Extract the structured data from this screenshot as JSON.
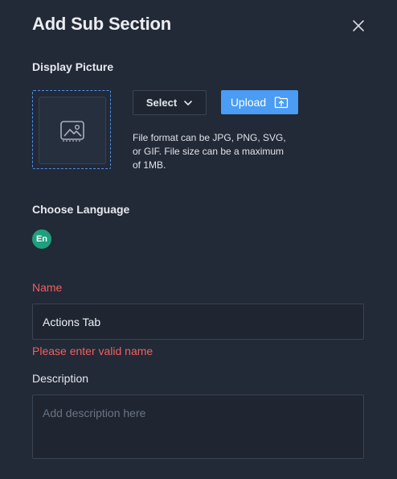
{
  "dialog": {
    "title": "Add Sub Section",
    "close_icon": "close-icon"
  },
  "display_picture": {
    "label": "Display Picture",
    "placeholder_icon": "image-icon",
    "select_label": "Select",
    "select_icon": "chevron-down-icon",
    "upload_label": "Upload",
    "upload_icon": "folder-upload-icon",
    "hint": "File format can be JPG, PNG, SVG, or GIF. File size can be a maximum of 1MB."
  },
  "language": {
    "label": "Choose Language",
    "selected": "En"
  },
  "name": {
    "label": "Name",
    "value": "Actions Tab",
    "error": "Please enter valid name"
  },
  "description": {
    "label": "Description",
    "value": "",
    "placeholder": "Add description here"
  },
  "colors": {
    "background": "#222937",
    "accent": "#4a9cf4",
    "error": "#f25f5f",
    "language_badge": "#1e9f7d"
  }
}
